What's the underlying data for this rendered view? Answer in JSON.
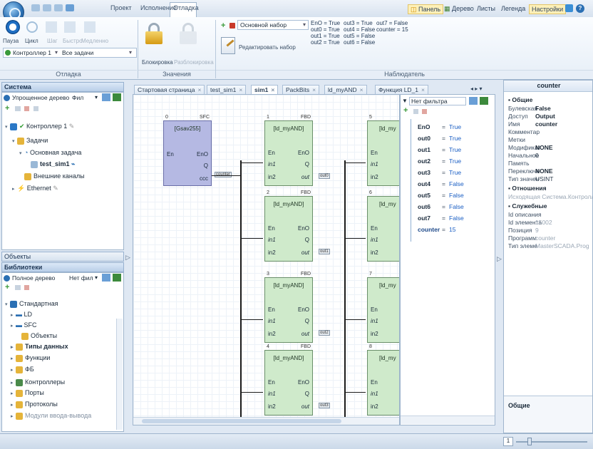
{
  "menu": {
    "project": "Проект",
    "execution": "Исполнение",
    "debug": "Отладка"
  },
  "top_right": {
    "panel": "Панель",
    "tree": "Дерево",
    "blurred1": "Листы",
    "legend": "Легенда",
    "settings": "Настройки"
  },
  "ribbon": {
    "debug_group": {
      "pause": "Пауза",
      "cycle": "Цикл",
      "step": "Шаг",
      "fast": "Быстро",
      "slow": "Медленно",
      "controller": "Контроллер 1",
      "tasks": "Все задачи",
      "label": "Отладка"
    },
    "values_group": {
      "lock": "Блокировка",
      "unlock": "Разблокировка",
      "label": "Значения"
    },
    "observer_group": {
      "set_select": "Основной набор",
      "edit_set": "Редактировать набор",
      "label": "Наблюдатель",
      "cols": [
        [
          "EnO = True",
          "out0 = True",
          "out1 = True",
          "out2 = True"
        ],
        [
          "out3 = True",
          "out4 = False",
          "out5 = False",
          "out6 = False"
        ],
        [
          "out7 = False",
          "counter = 15"
        ]
      ]
    }
  },
  "left": {
    "system_title": "Система",
    "view_select": "Упрощенное дерево",
    "filter": "Фил",
    "tree": [
      "Контроллер 1",
      "Задачи",
      "Основная задача",
      "test_sim1",
      "Внешние каналы",
      "Ethernet"
    ],
    "objects_title": "Объекты",
    "library_title": "Библиотеки",
    "lib_view": "Полное дерево",
    "lib_filter": "Нет фил",
    "lib_tree": [
      "Стандартная",
      "LD",
      "SFC",
      "Объекты",
      "Типы данных",
      "Функции",
      "ФБ",
      "Контроллеры",
      "Порты",
      "Протоколы",
      "Модули ввода-вывода"
    ]
  },
  "doc_tabs": [
    "Стартовая страница",
    "test_sim1",
    "sim1",
    "PackBits",
    "ld_myAND",
    "Функция LD_1"
  ],
  "canvas": {
    "gsav": {
      "title": "[Gsav255]",
      "en": "En",
      "eno": "EnO",
      "q": "Q",
      "ccc": "ccc",
      "num": "0",
      "ord": "SFC"
    },
    "block_title": "[ld_myAND]",
    "block_title_cut": "[ld_my",
    "pins": {
      "en": "En",
      "eno": "EnO",
      "in1": "in1",
      "q": "Q",
      "in2": "in2",
      "out": "out"
    },
    "nums": [
      "1",
      "2",
      "3",
      "4"
    ],
    "nums2": [
      "5",
      "6",
      "7",
      "8"
    ],
    "ord": "FBD",
    "tags": [
      "out0",
      "out1",
      "out2",
      "out3"
    ],
    "counter_tag": "counter"
  },
  "watch": {
    "filter": "Нет фильтра",
    "rows": [
      [
        "EnO",
        "True"
      ],
      [
        "out0",
        "True"
      ],
      [
        "out1",
        "True"
      ],
      [
        "out2",
        "True"
      ],
      [
        "out3",
        "True"
      ],
      [
        "out4",
        "False"
      ],
      [
        "out5",
        "False"
      ],
      [
        "out6",
        "False"
      ],
      [
        "out7",
        "False"
      ],
      [
        "counter",
        "15"
      ]
    ],
    "eq": "="
  },
  "props": {
    "title": "counter",
    "general": "Общие",
    "rows": [
      [
        "Булевская",
        "False"
      ],
      [
        "Доступ",
        "Output"
      ],
      [
        "Имя",
        "counter"
      ],
      [
        "Комментар",
        ""
      ],
      [
        "Метки",
        ""
      ],
      [
        "Модификат",
        "NONE"
      ],
      [
        "Начальное",
        "0"
      ],
      [
        "Память",
        ""
      ],
      [
        "Переключе",
        "NONE"
      ],
      [
        "Тип значен",
        "USINT"
      ]
    ],
    "relations": "Отношения",
    "rel_row": "Исходящая Система.Контролле",
    "service": "Служебные",
    "svc_rows": [
      [
        "Id описания",
        ""
      ],
      [
        "Id элемента",
        "15002"
      ],
      [
        "Позиция",
        "9"
      ],
      [
        "Программ",
        "counter"
      ],
      [
        "Тип элеме",
        "MasterSCADA.Prog"
      ]
    ],
    "footer": "Общие"
  },
  "status": {
    "page": "1"
  },
  "colors": {
    "accent": "#2a6fb3",
    "block": "#cfeacb",
    "gsav": "#b5b9e3",
    "true": "#1b5fc4"
  }
}
